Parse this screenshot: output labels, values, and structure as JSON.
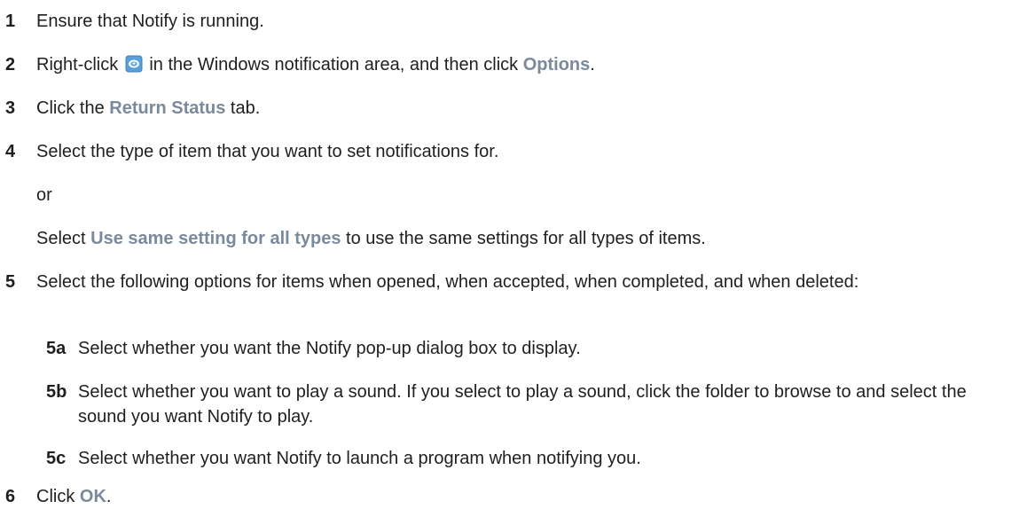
{
  "steps": [
    {
      "num": "1",
      "text": "Ensure that Notify is running."
    },
    {
      "num": "2",
      "pre": "Right-click ",
      "mid": " in the Windows notification area, and then click ",
      "ui": "Options",
      "post": "."
    },
    {
      "num": "3",
      "pre": "Click the ",
      "ui": "Return Status",
      "post": " tab."
    },
    {
      "num": "4",
      "text": "Select the type of item that you want to set notifications for."
    },
    {
      "or": "or"
    },
    {
      "pre": "Select ",
      "ui": "Use same setting for all types",
      "post": " to use the same settings for all types of items."
    },
    {
      "num": "5",
      "text": "Select the following options for items when opened, when accepted, when completed, and when deleted:"
    },
    {
      "num": "5a",
      "text": "Select whether you want the Notify pop-up dialog box to display."
    },
    {
      "num": "5b",
      "text": "Select whether you want to play a sound. If you select to play a sound, click the folder to browse to and select the sound you want Notify to play."
    },
    {
      "num": "5c",
      "text": "Select whether you want Notify to launch a program when notifying you."
    },
    {
      "num": "6",
      "pre": "Click ",
      "ui": "OK",
      "post": "."
    }
  ],
  "icons": {
    "tray": "notify-tray-icon"
  },
  "colors": {
    "ui_label": "#7a8a9c",
    "text": "#1f1f1f",
    "icon_blue": "#5aa0d8"
  }
}
